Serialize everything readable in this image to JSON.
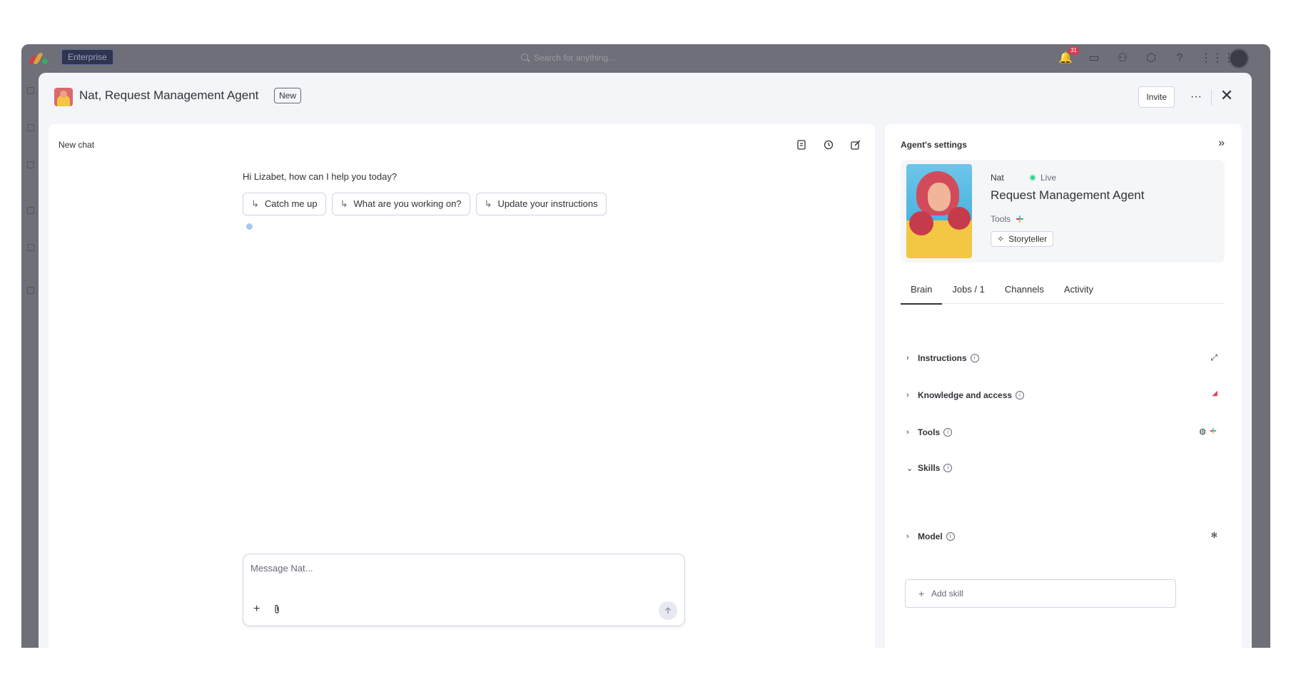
{
  "topbar": {
    "enterprise_label": "Enterprise",
    "search_placeholder": "Search for anything...",
    "notification_count": "31"
  },
  "modal": {
    "title": "Nat, Request Management Agent",
    "badge": "New",
    "invite_label": "Invite",
    "more_label": "···",
    "close_label": "✕"
  },
  "chat": {
    "title": "New chat",
    "greeting": "Hi Lizabet, how can I help you today?",
    "suggestions": [
      {
        "label": "Catch me up"
      },
      {
        "label": "What are you working on?"
      },
      {
        "label": "Update your instructions"
      }
    ],
    "composer_placeholder": "Message Nat...",
    "plus_label": "+"
  },
  "settings": {
    "title": "Agent's settings",
    "agent_name": "Nat",
    "status": "Live",
    "role": "Request Management Agent",
    "tools_label": "Tools",
    "persona_label": "Storyteller",
    "tabs": [
      {
        "label": "Brain"
      },
      {
        "label": "Jobs / 1"
      },
      {
        "label": "Channels"
      },
      {
        "label": "Activity"
      }
    ],
    "sections": [
      {
        "label": "Instructions"
      },
      {
        "label": "Knowledge and access"
      },
      {
        "label": "Tools"
      },
      {
        "label": "Skills"
      },
      {
        "label": "Model"
      }
    ],
    "add_skill_label": "Add skill"
  },
  "colors": {
    "live": "#33d391",
    "accent": "#0073ea",
    "backdrop": "#6e6f78"
  }
}
